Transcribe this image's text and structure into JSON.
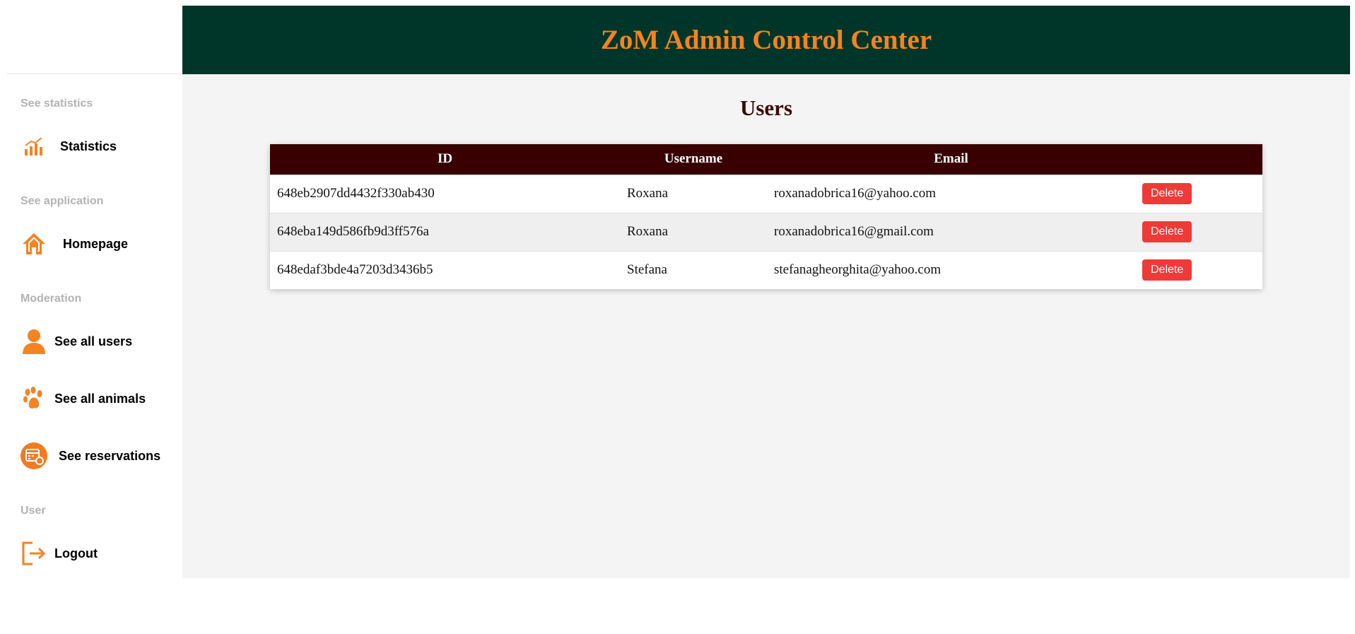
{
  "header": {
    "title": "ZoM Admin Control Center"
  },
  "sidebar": {
    "sections": [
      {
        "label": "See statistics"
      },
      {
        "label": "See application"
      },
      {
        "label": "Moderation"
      },
      {
        "label": "User"
      }
    ],
    "items": [
      {
        "label": "Statistics",
        "icon": "bar-chart-icon"
      },
      {
        "label": "Homepage",
        "icon": "home-icon"
      },
      {
        "label": "See all users",
        "icon": "user-icon"
      },
      {
        "label": "See all animals",
        "icon": "paw-icon"
      },
      {
        "label": "See reservations",
        "icon": "calendar-icon"
      },
      {
        "label": "Logout",
        "icon": "logout-icon"
      }
    ]
  },
  "main": {
    "title": "Users",
    "table": {
      "headers": [
        "ID",
        "Username",
        "Email",
        ""
      ],
      "rows": [
        {
          "id": "648eb2907dd4432f330ab430",
          "username": "Roxana",
          "email": "roxanadobrica16@yahoo.com",
          "action": "Delete"
        },
        {
          "id": "648eba149d586fb9d3ff576a",
          "username": "Roxana",
          "email": "roxanadobrica16@gmail.com",
          "action": "Delete"
        },
        {
          "id": "648edaf3bde4a7203d3436b5",
          "username": "Stefana",
          "email": "stefanagheorghita@yahoo.com",
          "action": "Delete"
        }
      ]
    }
  },
  "colors": {
    "header_bg": "#003629",
    "brand_orange": "#f48321",
    "table_header_bg": "#380000",
    "delete_red": "#ee3b37",
    "main_bg": "#f4f4f4"
  }
}
